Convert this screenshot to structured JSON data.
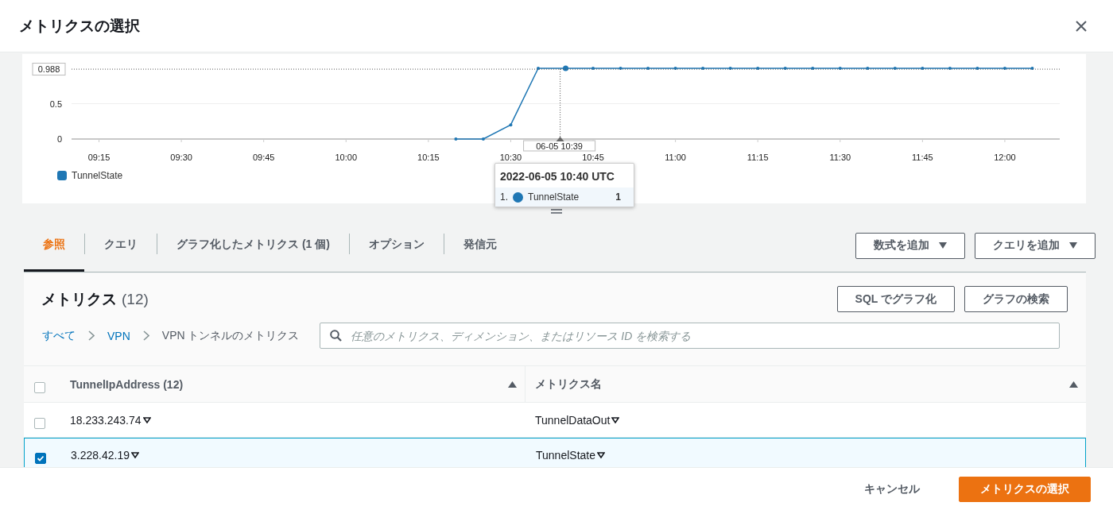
{
  "dialog": {
    "title": "メトリクスの選択"
  },
  "graph": {
    "chart_data": {
      "type": "line",
      "x": [
        "2022-06-05T10:20",
        "2022-06-05T10:25",
        "2022-06-05T10:30",
        "2022-06-05T10:35",
        "2022-06-05T10:40",
        "2022-06-05T10:45",
        "2022-06-05T10:50",
        "2022-06-05T10:55",
        "2022-06-05T11:00",
        "2022-06-05T11:05",
        "2022-06-05T11:10",
        "2022-06-05T11:15",
        "2022-06-05T11:20",
        "2022-06-05T11:25",
        "2022-06-05T11:30",
        "2022-06-05T11:35",
        "2022-06-05T11:40",
        "2022-06-05T11:45",
        "2022-06-05T11:50",
        "2022-06-05T11:55",
        "2022-06-05T12:00",
        "2022-06-05T12:05"
      ],
      "series": [
        {
          "name": "TunnelState",
          "color": "#1f77b4",
          "values": [
            0,
            0,
            0.2,
            1,
            1,
            1,
            1,
            1,
            1,
            1,
            1,
            1,
            1,
            1,
            1,
            1,
            1,
            1,
            1,
            1,
            1,
            1
          ]
        }
      ],
      "xlim": [
        "2022-06-05T09:10",
        "2022-06-05T12:10"
      ],
      "ylim": [
        0,
        1
      ],
      "xticks": [
        {
          "value": "2022-06-05T09:15",
          "label": "09:15"
        },
        {
          "value": "2022-06-05T09:30",
          "label": "09:30"
        },
        {
          "value": "2022-06-05T09:45",
          "label": "09:45"
        },
        {
          "value": "2022-06-05T10:00",
          "label": "10:00"
        },
        {
          "value": "2022-06-05T10:15",
          "label": "10:15"
        },
        {
          "value": "2022-06-05T10:30",
          "label": "10:30"
        },
        {
          "value": "2022-06-05T10:45",
          "label": "10:45"
        },
        {
          "value": "2022-06-05T11:00",
          "label": "11:00"
        },
        {
          "value": "2022-06-05T11:15",
          "label": "11:15"
        },
        {
          "value": "2022-06-05T11:30",
          "label": "11:30"
        },
        {
          "value": "2022-06-05T11:45",
          "label": "11:45"
        },
        {
          "value": "2022-06-05T12:00",
          "label": "12:00"
        }
      ],
      "yticks": [
        {
          "value": 0,
          "label": "0"
        },
        {
          "value": 0.5,
          "label": "0.5"
        }
      ],
      "ref_lines": [
        {
          "axis": "y",
          "value": 0.988,
          "label": "0.988"
        },
        {
          "axis": "x",
          "value": "2022-06-05T10:39",
          "label": "06-05 10:39"
        }
      ]
    },
    "tooltip": {
      "title": "2022-06-05 10:40 UTC",
      "rows": [
        {
          "index": "1.",
          "name": "TunnelState",
          "value": "1",
          "color": "#1f77b4"
        }
      ]
    }
  },
  "tabs": [
    {
      "label": "参照",
      "selected": true
    },
    {
      "label": "クエリ",
      "selected": false
    },
    {
      "label": "グラフ化したメトリクス (1 個)",
      "selected": false
    },
    {
      "label": "オプション",
      "selected": false
    },
    {
      "label": "発信元",
      "selected": false
    }
  ],
  "tab_actions": [
    "数式を追加",
    "クエリを追加"
  ],
  "metrics": {
    "title": "メトリクス",
    "count": "(12)",
    "actions": [
      "SQL でグラフ化",
      "グラフの検索"
    ],
    "breadcrumb": [
      {
        "label": "すべて",
        "link": true
      },
      {
        "label": "VPN",
        "link": true
      },
      {
        "label": "VPN トンネルのメトリクス",
        "link": false
      }
    ],
    "search": {
      "placeholder": "任意のメトリクス、ディメンション、またはリソース ID を検索する"
    },
    "table": {
      "select_all": {
        "checked": false
      },
      "columns": [
        "TunnelIpAddress (12)",
        "メトリクス名"
      ],
      "rows": [
        {
          "selected": false,
          "checked": false,
          "cells": [
            "18.233.243.74",
            "TunnelDataOut"
          ]
        },
        {
          "selected": true,
          "checked": true,
          "cells": [
            "3.228.42.19",
            "TunnelState"
          ]
        }
      ]
    }
  },
  "footer": {
    "buttons": [
      {
        "label": "キャンセル",
        "kind": "link"
      },
      {
        "label": "メトリクスの選択",
        "kind": "primary"
      }
    ]
  }
}
